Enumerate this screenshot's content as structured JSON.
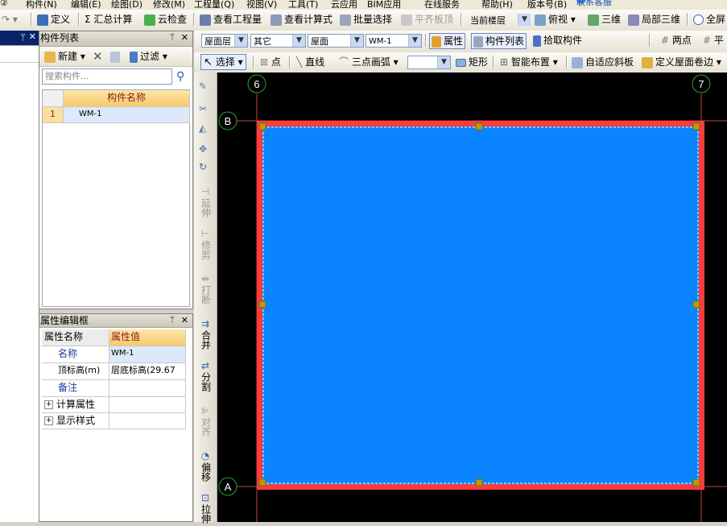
{
  "menu": [
    "②",
    "构件(N)",
    "编辑(E)",
    "绘图(D)",
    "修改(M)",
    "工程量(Q)",
    "视图(V)",
    "工具(T)",
    "云应用",
    "BIM应用",
    "在线服务",
    "帮助(H)",
    "版本号(B)",
    "联系客服"
  ],
  "toolbar1": {
    "define": "定义",
    "sum_calc": "Σ 汇总计算",
    "cloud_check": "云检查",
    "view_qty": "查看工程量",
    "view_formula": "查看计算式",
    "batch_select": "批量选择",
    "flatten_slab": "平齐板顶",
    "floor_combo": "当前楼层",
    "view_top": "俯视",
    "three_d": "三维",
    "local_3d": "局部三维",
    "fullscreen": "全屏"
  },
  "toolbar2": {
    "combo_floor": "屋面层",
    "combo_type": "其它",
    "combo_category": "屋面",
    "combo_component": "WM-1",
    "properties": "属性",
    "component_list": "构件列表",
    "pick_component": "拾取构件",
    "two_point": "两点",
    "parallel": "平"
  },
  "toolbar3": {
    "select": "选择",
    "point": "点",
    "line": "直线",
    "arc3": "三点画弧",
    "arc_combo": "",
    "rectangle": "矩形",
    "smart_layout": "智能布置",
    "adaptive_slope": "自适应斜板",
    "define_roof_edge": "定义屋面卷边"
  },
  "component_panel": {
    "title": "构件列表",
    "new": "新建",
    "filter": "过滤",
    "search_placeholder": "搜索构件...",
    "col_name": "构件名称",
    "rows": [
      {
        "index": "1",
        "name": "WM-1"
      }
    ]
  },
  "property_panel": {
    "title": "属性编辑框",
    "col_name": "属性名称",
    "col_value": "属性值",
    "rows": [
      {
        "name": "名称",
        "value": "WM-1",
        "expand": ""
      },
      {
        "name": "顶标高(m)",
        "value": "层底标高(29.67",
        "expand": ""
      },
      {
        "name": "备注",
        "value": "",
        "expand": ""
      },
      {
        "name": "计算属性",
        "value": "",
        "expand": "+"
      },
      {
        "name": "显示样式",
        "value": "",
        "expand": "+"
      }
    ]
  },
  "vertical_tools": [
    {
      "label": "延伸",
      "enabled": false
    },
    {
      "label": "修剪",
      "enabled": false
    },
    {
      "label": "打断",
      "enabled": false
    },
    {
      "label": "合并",
      "enabled": true
    },
    {
      "label": "分割",
      "enabled": true
    },
    {
      "label": "对齐",
      "enabled": false
    },
    {
      "label": "偏移",
      "enabled": true
    },
    {
      "label": "拉伸",
      "enabled": true
    }
  ],
  "canvas": {
    "axis_labels": [
      "6",
      "7",
      "B",
      "A"
    ],
    "slab_color": "#0a84ff",
    "border_color": "#ff3b3b",
    "background": "#000000"
  }
}
